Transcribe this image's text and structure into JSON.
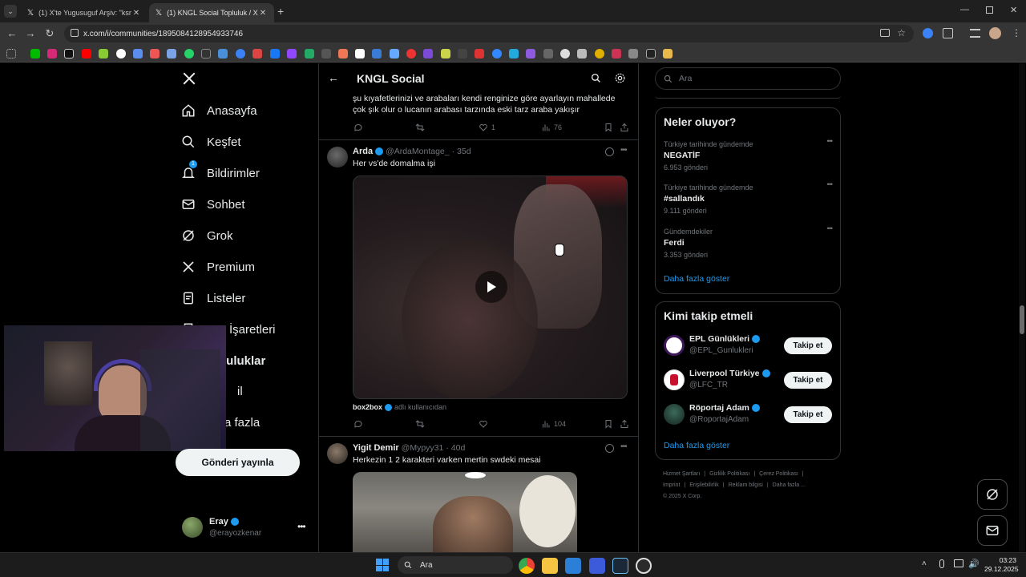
{
  "browser": {
    "tabs": [
      {
        "label": "(1) X'te Yugusuguf Arşiv: \"ksme"
      },
      {
        "label": "(1) KNGL Social Topluluk / X"
      }
    ],
    "url": "x.com/i/communities/1895084128954933746"
  },
  "sidebar": {
    "items": [
      {
        "label": "Anasayfa",
        "icon": "home-icon"
      },
      {
        "label": "Keşfet",
        "icon": "search-icon"
      },
      {
        "label": "Bildirimler",
        "icon": "bell-icon",
        "badge": "1"
      },
      {
        "label": "Sohbet",
        "icon": "mail-icon"
      },
      {
        "label": "Grok",
        "icon": "grok-icon"
      },
      {
        "label": "Premium",
        "icon": "x-logo-icon"
      },
      {
        "label": "Listeler",
        "icon": "list-icon"
      },
      {
        "label": "Yer İşaretleri",
        "icon": "bookmark-icon"
      },
      {
        "label": "Topluluklar",
        "icon": "communities-icon"
      },
      {
        "label": "Profil",
        "icon": "profile-icon"
      },
      {
        "label": "Daha fazla",
        "icon": "more-icon"
      }
    ],
    "visible_partial": [
      "İşaretleri",
      "luluklar",
      "il",
      "a fazla"
    ],
    "post_button": "Gönderi yayınla",
    "account": {
      "name": "Eray",
      "handle": "@erayozkenar"
    }
  },
  "header": {
    "title": "KNGL Social"
  },
  "posts": [
    {
      "text": "şu kıyafetlerinizi ve arabaları kendi renginize göre ayarlayın mahallede çok şık olur o lucanın arabası tarzında eski tarz araba yakışır",
      "likes": "1",
      "views": "76"
    },
    {
      "name": "Arda",
      "handle": "@ArdaMontage_",
      "time": "· 35d",
      "text": "Her vs'de domalma işi",
      "attribution_user": "box2box",
      "attribution_text": "adlı kullanıcıdan",
      "views": "104"
    },
    {
      "name": "Yigit Demir",
      "handle": "@Mypyy31",
      "time": "· 40d",
      "text": "Herkezin 1 2 karakteri varken mertin swdeki mesai"
    }
  ],
  "right": {
    "search_placeholder": "Ara",
    "trends_title": "Neler oluyor?",
    "trends": [
      {
        "category": "Türkiye tarihinde gündemde",
        "title": "NEGATİF",
        "count": "6.953 gönderi"
      },
      {
        "category": "Türkiye tarihinde gündemde",
        "title": "#sallandık",
        "count": "9.111 gönderi"
      },
      {
        "category": "Gündemdekiler",
        "title": "Ferdi",
        "count": "3.353 gönderi"
      }
    ],
    "show_more": "Daha fazla göster",
    "follow_title": "Kimi takip etmeli",
    "follow_button": "Takip et",
    "follow": [
      {
        "name": "EPL Günlükleri",
        "handle": "@EPL_Gunlukleri"
      },
      {
        "name": "Liverpool Türkiye",
        "handle": "@LFC_TR"
      },
      {
        "name": "Röportaj Adam",
        "handle": "@RoportajAdam"
      }
    ],
    "footer": {
      "l1": [
        "Hizmet Şartları",
        "Gizlilik Politikası",
        "Çerez Politikası"
      ],
      "l2": [
        "Imprint",
        "Erişilebilirlik",
        "Reklam bilgisi",
        "Daha fazla ..."
      ],
      "copyright": "© 2025 X Corp."
    }
  },
  "taskbar": {
    "search": "Ara",
    "time": "03:23",
    "date": "29.12.2025"
  },
  "colors": {
    "accent": "#1d9bf0",
    "background": "#000000",
    "border": "#2f3336"
  }
}
